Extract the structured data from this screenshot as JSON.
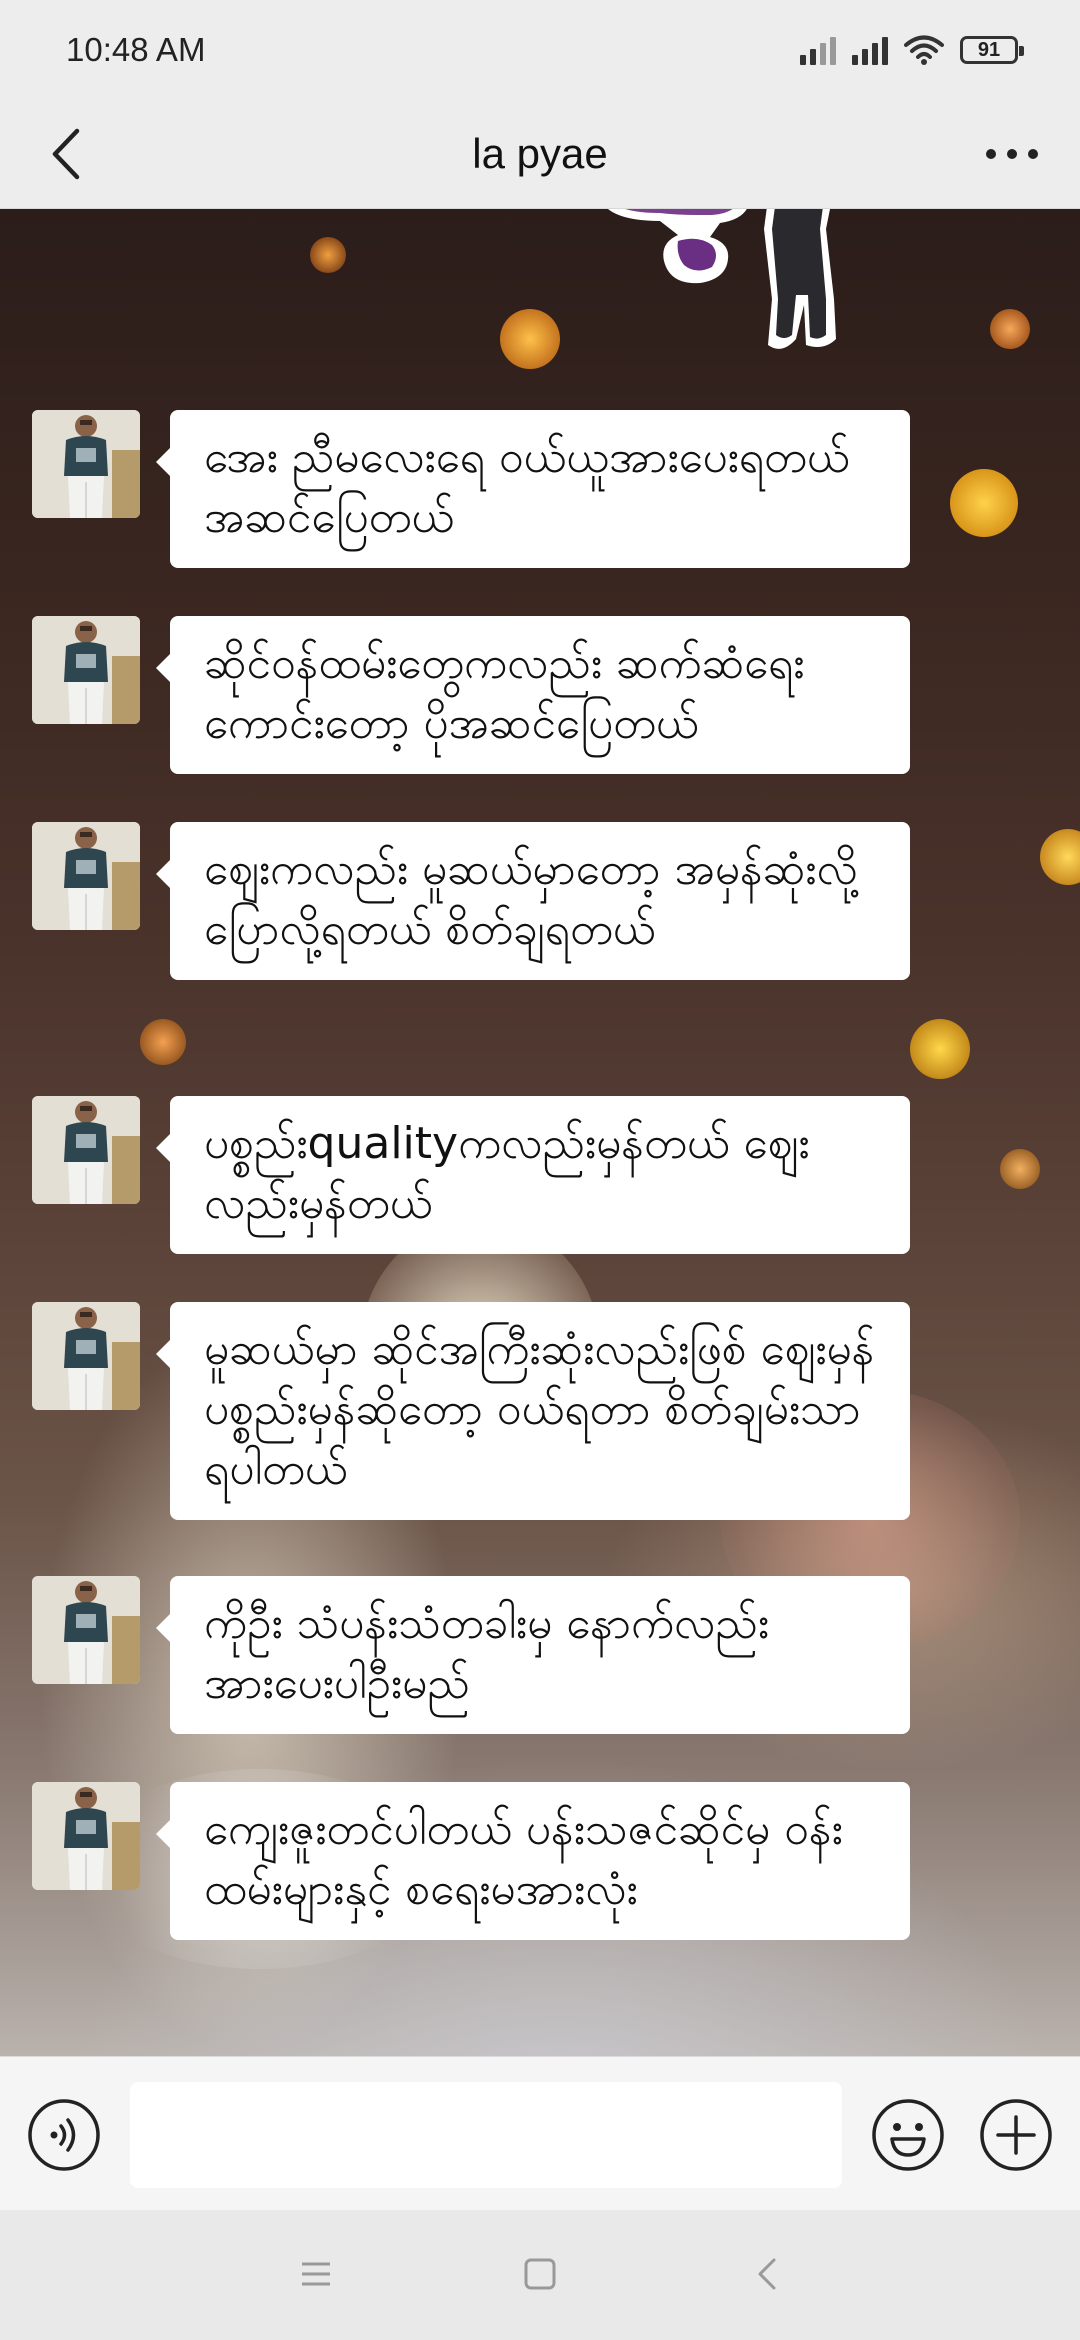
{
  "status_bar": {
    "time": "10:48 AM",
    "battery": "91"
  },
  "header": {
    "title": "la pyae",
    "back_icon": "chevron-left-icon",
    "more_icon": "more-horizontal-icon"
  },
  "messages": [
    {
      "text": "အေး ညီမလေးရေ ဝယ်ယူအားပေးရတယ် အဆင်ပြေတယ်"
    },
    {
      "text": "ဆိုင်ဝန်ထမ်းတွေကလည်း ဆက်ဆံရေးကောင်းတော့ ပိုအဆင်ပြေတယ်"
    },
    {
      "text": "ဈေးကလည်း မူဆယ်မှာတော့ အမှန်ဆုံးလို့ပြောလို့ရတယ် စိတ်ချရတယ်"
    },
    {
      "text": "ပစ္စည်းqualityကလည်းမှန်တယ် ဈေးလည်းမှန်တယ်"
    },
    {
      "text": "မူဆယ်မှာ ဆိုင်အကြီးဆုံးလည်းဖြစ် ဈေးမှန်ပစ္စည်းမှန်ဆိုတော့ ဝယ်ရတာ စိတ်ချမ်းသာရပါတယ်"
    },
    {
      "text": "ကိုဦး သံပန်းသံတခါးမှ နောက်လည်း အားပေးပါဦးမည်"
    },
    {
      "text": "ကျေးဇူးတင်ပါတယ် ပန်းသဇင်ဆိုင်မှ ဝန်းထမ်းများနှင့် စရေးမအားလုံး"
    }
  ],
  "input_bar": {
    "placeholder": "",
    "voice_icon": "voice-icon",
    "emoji_icon": "emoji-icon",
    "plus_icon": "plus-icon"
  },
  "nav_bar": {
    "menu_icon": "menu-icon",
    "home_icon": "home-square-icon",
    "back_icon": "back-triangle-icon"
  },
  "colors": {
    "bubble": "#ffffff",
    "header_bg": "#ededed",
    "text": "#111111"
  }
}
